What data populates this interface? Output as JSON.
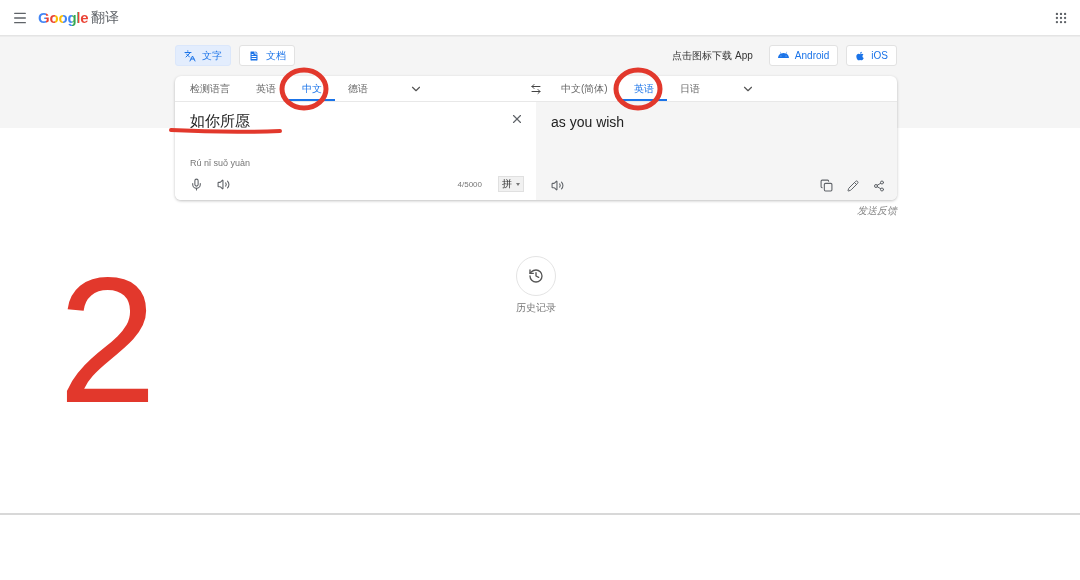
{
  "header": {
    "logo": "Google",
    "product": "翻译"
  },
  "mode_buttons": [
    {
      "label": "文字",
      "kind": "text",
      "selected": true
    },
    {
      "label": "文档",
      "kind": "document",
      "selected": false
    }
  ],
  "app_prompt": "点击图标下载 App",
  "app_buttons": [
    {
      "label": "Android",
      "kind": "android"
    },
    {
      "label": "iOS",
      "kind": "ios"
    }
  ],
  "source_languages": [
    {
      "label": "检测语言",
      "selected": false
    },
    {
      "label": "英语",
      "selected": false
    },
    {
      "label": "中文",
      "selected": true
    },
    {
      "label": "德语",
      "selected": false
    }
  ],
  "target_languages": [
    {
      "label": "中文(简体)",
      "selected": false
    },
    {
      "label": "英语",
      "selected": true
    },
    {
      "label": "日语",
      "selected": false
    }
  ],
  "source": {
    "text": "如你所愿",
    "romanization": "Rú nǐ suǒ yuàn",
    "char_count": "4/5000",
    "ime": "拼"
  },
  "translation": {
    "text": "as you wish"
  },
  "feedback": "发送反馈",
  "history": "历史记录",
  "annotation": {
    "label": "2"
  }
}
